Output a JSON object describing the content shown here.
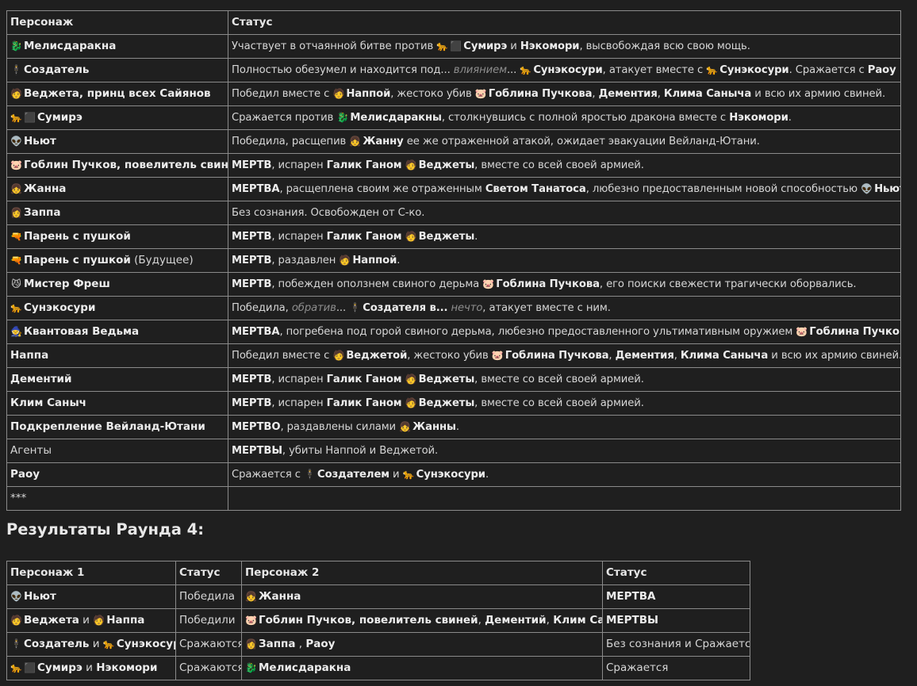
{
  "table1": {
    "headers": [
      "Персонаж",
      "Статус"
    ],
    "rows": [
      {
        "char": [
          [
            "i",
            "🐉"
          ],
          [
            "b",
            "Мелисдаракна"
          ]
        ],
        "status": [
          [
            "t",
            "Участвует в отчаянной битве против "
          ],
          [
            "i",
            "🐆"
          ],
          [
            "i",
            "⬛"
          ],
          [
            "b",
            "Сумирэ"
          ],
          [
            "t",
            " и "
          ],
          [
            "b",
            "Нэкомори"
          ],
          [
            "t",
            ", высвобождая всю свою мощь."
          ]
        ]
      },
      {
        "char": [
          [
            "i",
            "🕴"
          ],
          [
            "b",
            "Создатель"
          ]
        ],
        "status": [
          [
            "t",
            "Полностью обезумел и находится под... "
          ],
          [
            "e",
            "влиянием"
          ],
          [
            "t",
            "... "
          ],
          [
            "i",
            "🐆"
          ],
          [
            "b",
            "Сунэкосури"
          ],
          [
            "t",
            ", атакует вместе с "
          ],
          [
            "i",
            "🐆"
          ],
          [
            "b",
            "Сунэкосури"
          ],
          [
            "t",
            ". Сражается с "
          ],
          [
            "b",
            "Раоу"
          ]
        ]
      },
      {
        "char": [
          [
            "i",
            "🧑"
          ],
          [
            "b",
            "Веджета, принц всех Сайянов"
          ]
        ],
        "status": [
          [
            "t",
            "Победил вместе с "
          ],
          [
            "i",
            "🧑"
          ],
          [
            "b",
            "Наппой"
          ],
          [
            "t",
            ", жестоко убив "
          ],
          [
            "i",
            "🐷"
          ],
          [
            "b",
            "Гоблина Пучкова"
          ],
          [
            "t",
            ", "
          ],
          [
            "b",
            "Дементия"
          ],
          [
            "t",
            ", "
          ],
          [
            "b",
            "Клима Саныча"
          ],
          [
            "t",
            " и всю их армию свиней."
          ]
        ]
      },
      {
        "char": [
          [
            "i",
            "🐆"
          ],
          [
            "i",
            "⬛"
          ],
          [
            "b",
            "Сумирэ"
          ]
        ],
        "status": [
          [
            "t",
            "Сражается против "
          ],
          [
            "i",
            "🐉"
          ],
          [
            "b",
            "Мелисдаракны"
          ],
          [
            "t",
            ", столкнувшись с полной яростью дракона вместе с "
          ],
          [
            "b",
            "Нэкомори"
          ],
          [
            "t",
            "."
          ]
        ]
      },
      {
        "char": [
          [
            "i",
            "👽"
          ],
          [
            "b",
            "Ньют"
          ]
        ],
        "status": [
          [
            "t",
            "Победила, расщепив "
          ],
          [
            "i",
            "👧"
          ],
          [
            "b",
            "Жанну"
          ],
          [
            "t",
            " ее же отраженной атакой, ожидает эвакуации Вейланд-Ютани."
          ]
        ]
      },
      {
        "char": [
          [
            "i",
            "🐷"
          ],
          [
            "b",
            "Гоблин Пучков, повелитель свиней"
          ]
        ],
        "status": [
          [
            "b",
            "МЕРТВ"
          ],
          [
            "t",
            ", испарен "
          ],
          [
            "b",
            "Галик Ганом"
          ],
          [
            "t",
            " "
          ],
          [
            "i",
            "🧑"
          ],
          [
            "b",
            "Веджеты"
          ],
          [
            "t",
            ", вместе со всей своей армией."
          ]
        ]
      },
      {
        "char": [
          [
            "i",
            "👧"
          ],
          [
            "b",
            "Жанна"
          ]
        ],
        "status": [
          [
            "b",
            "МЕРТВА"
          ],
          [
            "t",
            ", расщеплена своим же отраженным "
          ],
          [
            "b",
            "Светом Танатоса"
          ],
          [
            "t",
            ", любезно предоставленным новой способностью "
          ],
          [
            "i",
            "👽"
          ],
          [
            "b",
            "Ньют"
          ],
          [
            "t",
            "."
          ]
        ]
      },
      {
        "char": [
          [
            "i",
            "👩"
          ],
          [
            "b",
            "Заппа"
          ]
        ],
        "status": [
          [
            "t",
            "Без сознания. Освобожден от С-ко."
          ]
        ]
      },
      {
        "char": [
          [
            "i",
            "🔫"
          ],
          [
            "b",
            "Парень с пушкой"
          ]
        ],
        "status": [
          [
            "b",
            "МЕРТВ"
          ],
          [
            "t",
            ", испарен "
          ],
          [
            "b",
            "Галик Ганом"
          ],
          [
            "t",
            " "
          ],
          [
            "i",
            "🧑"
          ],
          [
            "b",
            "Веджеты"
          ],
          [
            "t",
            "."
          ]
        ]
      },
      {
        "char": [
          [
            "i",
            "🔫"
          ],
          [
            "b",
            "Парень с пушкой"
          ],
          [
            "t",
            " (Будущее)"
          ]
        ],
        "status": [
          [
            "b",
            "МЕРТВ"
          ],
          [
            "t",
            ", раздавлен "
          ],
          [
            "i",
            "🧑"
          ],
          [
            "b",
            "Наппой"
          ],
          [
            "t",
            "."
          ]
        ]
      },
      {
        "char": [
          [
            "i",
            "😼"
          ],
          [
            "b",
            "Мистер Фреш"
          ]
        ],
        "status": [
          [
            "b",
            "МЕРТВ"
          ],
          [
            "t",
            ", побежден оползнем свиного дерьма "
          ],
          [
            "i",
            "🐷"
          ],
          [
            "b",
            "Гоблина Пучкова"
          ],
          [
            "t",
            ", его поиски свежести трагически оборвались."
          ]
        ]
      },
      {
        "char": [
          [
            "i",
            "🐆"
          ],
          [
            "b",
            "Сунэкосури"
          ]
        ],
        "status": [
          [
            "t",
            "Победила, "
          ],
          [
            "e",
            "обратив"
          ],
          [
            "t",
            "... "
          ],
          [
            "i",
            "🕴"
          ],
          [
            "b",
            "Создателя в..."
          ],
          [
            "t",
            " "
          ],
          [
            "e",
            "нечто"
          ],
          [
            "t",
            ", атакует вместе с ним."
          ]
        ]
      },
      {
        "char": [
          [
            "i",
            "🧙"
          ],
          [
            "b",
            "Квантовая Ведьма"
          ]
        ],
        "status": [
          [
            "b",
            "МЕРТВА"
          ],
          [
            "t",
            ", погребена под горой свиного дерьма, любезно предоставленного ультимативным оружием "
          ],
          [
            "i",
            "🐷"
          ],
          [
            "b",
            "Гоблина Пучкова"
          ],
          [
            "t",
            "."
          ]
        ]
      },
      {
        "char": [
          [
            "b",
            "Наппа"
          ]
        ],
        "status": [
          [
            "t",
            "Победил вместе с "
          ],
          [
            "i",
            "🧑"
          ],
          [
            "b",
            "Веджетой"
          ],
          [
            "t",
            ", жестоко убив "
          ],
          [
            "i",
            "🐷"
          ],
          [
            "b",
            "Гоблина Пучкова"
          ],
          [
            "t",
            ", "
          ],
          [
            "b",
            "Дементия"
          ],
          [
            "t",
            ", "
          ],
          [
            "b",
            "Клима Саныча"
          ],
          [
            "t",
            " и всю их армию свиней."
          ]
        ]
      },
      {
        "char": [
          [
            "b",
            "Дементий"
          ]
        ],
        "status": [
          [
            "b",
            "МЕРТВ"
          ],
          [
            "t",
            ", испарен "
          ],
          [
            "b",
            "Галик Ганом"
          ],
          [
            "t",
            " "
          ],
          [
            "i",
            "🧑"
          ],
          [
            "b",
            "Веджеты"
          ],
          [
            "t",
            ", вместе со всей своей армией."
          ]
        ]
      },
      {
        "char": [
          [
            "b",
            "Клим Саныч"
          ]
        ],
        "status": [
          [
            "b",
            "МЕРТВ"
          ],
          [
            "t",
            ", испарен "
          ],
          [
            "b",
            "Галик Ганом"
          ],
          [
            "t",
            " "
          ],
          [
            "i",
            "🧑"
          ],
          [
            "b",
            "Веджеты"
          ],
          [
            "t",
            ", вместе со всей своей армией."
          ]
        ]
      },
      {
        "char": [
          [
            "b",
            "Подкрепление Вейланд-Ютани"
          ]
        ],
        "status": [
          [
            "b",
            "МЕРТВО"
          ],
          [
            "t",
            ", раздавлены силами "
          ],
          [
            "i",
            "👧"
          ],
          [
            "b",
            "Жанны"
          ],
          [
            "t",
            "."
          ]
        ]
      },
      {
        "char": [
          [
            "t",
            "Агенты"
          ]
        ],
        "status": [
          [
            "b",
            "МЕРТВЫ"
          ],
          [
            "t",
            ", убиты Наппой и Веджетой."
          ]
        ]
      },
      {
        "char": [
          [
            "b",
            "Раоу"
          ]
        ],
        "status": [
          [
            "t",
            "Сражается с "
          ],
          [
            "i",
            "🕴"
          ],
          [
            "b",
            "Создателем"
          ],
          [
            "t",
            " и "
          ],
          [
            "i",
            "🐆"
          ],
          [
            "b",
            "Сунэкосури"
          ],
          [
            "t",
            "."
          ]
        ]
      },
      {
        "char": [
          [
            "t",
            "***"
          ]
        ],
        "status": []
      }
    ]
  },
  "heading": "Результаты Раунда 4:",
  "table2": {
    "headers": [
      "Персонаж 1",
      "Статус",
      "Персонаж 2",
      "Статус"
    ],
    "rows": [
      {
        "c1": [
          [
            "i",
            "👽"
          ],
          [
            "b",
            "Ньют"
          ]
        ],
        "s1": [
          [
            "t",
            "Победила"
          ]
        ],
        "c2": [
          [
            "i",
            "👧"
          ],
          [
            "b",
            "Жанна"
          ]
        ],
        "s2": [
          [
            "b",
            "МЕРТВА"
          ]
        ]
      },
      {
        "c1": [
          [
            "i",
            "🧑"
          ],
          [
            "b",
            "Веджета"
          ],
          [
            "t",
            " и "
          ],
          [
            "i",
            "🧑"
          ],
          [
            "b",
            "Наппа"
          ]
        ],
        "s1": [
          [
            "t",
            "Победили"
          ]
        ],
        "c2": [
          [
            "i",
            "🐷"
          ],
          [
            "b",
            "Гоблин Пучков, повелитель свиней"
          ],
          [
            "t",
            ", "
          ],
          [
            "b",
            "Дементий"
          ],
          [
            "t",
            ", "
          ],
          [
            "b",
            "Клим Саныч"
          ]
        ],
        "s2": [
          [
            "b",
            "МЕРТВЫ"
          ]
        ]
      },
      {
        "c1": [
          [
            "i",
            "🕴"
          ],
          [
            "b",
            "Создатель"
          ],
          [
            "t",
            " и "
          ],
          [
            "i",
            "🐆"
          ],
          [
            "b",
            "Сунэкосури"
          ]
        ],
        "s1": [
          [
            "t",
            "Сражаются"
          ]
        ],
        "c2": [
          [
            "i",
            "👩"
          ],
          [
            "b",
            "Заппа"
          ],
          [
            "t",
            " , "
          ],
          [
            "b",
            "Раоу"
          ]
        ],
        "s2": [
          [
            "t",
            "Без сознания и Сражается"
          ]
        ]
      },
      {
        "c1": [
          [
            "i",
            "🐆"
          ],
          [
            "i",
            "⬛"
          ],
          [
            "b",
            "Сумирэ"
          ],
          [
            "t",
            " и "
          ],
          [
            "b",
            "Нэкомори"
          ]
        ],
        "s1": [
          [
            "t",
            "Сражаются"
          ]
        ],
        "c2": [
          [
            "i",
            "🐉"
          ],
          [
            "b",
            "Мелисдаракна"
          ]
        ],
        "s2": [
          [
            "t",
            "Сражается"
          ]
        ]
      }
    ]
  },
  "icon_names": {
    "🐉": "dragon-icon",
    "🐆": "leopard-icon",
    "⬛": "black-square-icon",
    "🕴": "levitating-man-icon",
    "🧑": "person-icon",
    "🐷": "pig-face-icon",
    "👽": "alien-icon",
    "👧": "girl-icon",
    "👩": "woman-icon",
    "🔫": "pistol-icon",
    "😼": "smirking-cat-icon",
    "🧙": "mage-icon"
  }
}
